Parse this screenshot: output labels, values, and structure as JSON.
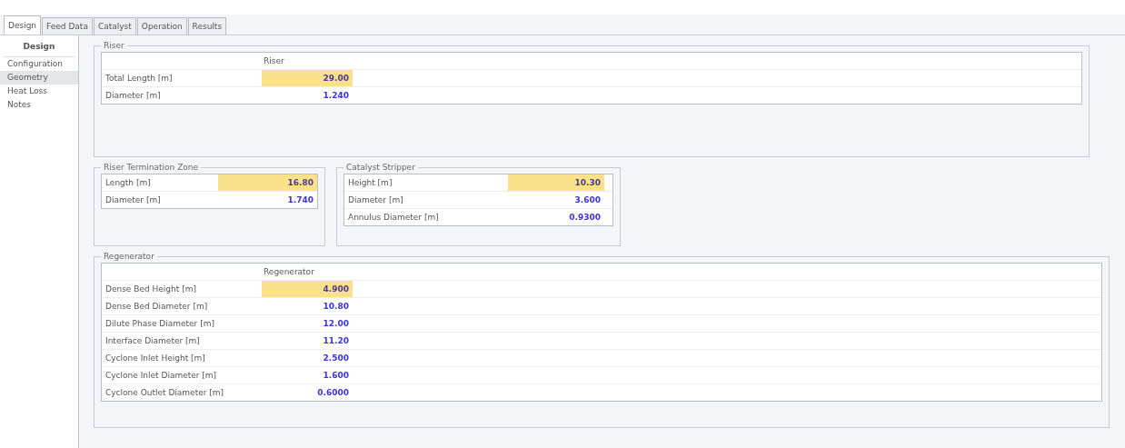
{
  "tabs": [
    {
      "label": "Design",
      "selected": true
    },
    {
      "label": "Feed Data",
      "selected": false
    },
    {
      "label": "Catalyst",
      "selected": false
    },
    {
      "label": "Operation",
      "selected": false
    },
    {
      "label": "Results",
      "selected": false
    }
  ],
  "sidebar": {
    "title": "Design",
    "items": [
      {
        "label": "Configuration",
        "selected": false
      },
      {
        "label": "Geometry",
        "selected": true
      },
      {
        "label": "Heat Loss",
        "selected": false
      },
      {
        "label": "Notes",
        "selected": false
      }
    ]
  },
  "riser": {
    "title": "Riser",
    "column": "Riser",
    "rows": [
      {
        "label": "Total Length [m]",
        "value": "29.00",
        "highlighted": true
      },
      {
        "label": "Diameter [m]",
        "value": "1.240",
        "highlighted": false
      }
    ]
  },
  "riser_termination_zone": {
    "title": "Riser Termination Zone",
    "rows": [
      {
        "label": "Length [m]",
        "value": "16.80",
        "highlighted": true
      },
      {
        "label": "Diameter [m]",
        "value": "1.740",
        "highlighted": false
      }
    ]
  },
  "catalyst_stripper": {
    "title": "Catalyst Stripper",
    "rows": [
      {
        "label": "Height [m]",
        "value": "10.30",
        "highlighted": true
      },
      {
        "label": "Diameter [m]",
        "value": "3.600",
        "highlighted": false
      },
      {
        "label": "Annulus Diameter [m]",
        "value": "0.9300",
        "highlighted": false
      }
    ]
  },
  "regenerator": {
    "title": "Regenerator",
    "column": "Regenerator",
    "rows": [
      {
        "label": "Dense Bed Height [m]",
        "value": "4.900",
        "highlighted": true
      },
      {
        "label": "Dense Bed Diameter [m]",
        "value": "10.80",
        "highlighted": false
      },
      {
        "label": "Dilute Phase Diameter [m]",
        "value": "12.00",
        "highlighted": false
      },
      {
        "label": "Interface Diameter [m]",
        "value": "11.20",
        "highlighted": false
      },
      {
        "label": "Cyclone Inlet Height [m]",
        "value": "2.500",
        "highlighted": false
      },
      {
        "label": "Cyclone Inlet Diameter [m]",
        "value": "1.600",
        "highlighted": false
      },
      {
        "label": "Cyclone Outlet Diameter [m]",
        "value": "0.6000",
        "highlighted": false
      }
    ]
  }
}
